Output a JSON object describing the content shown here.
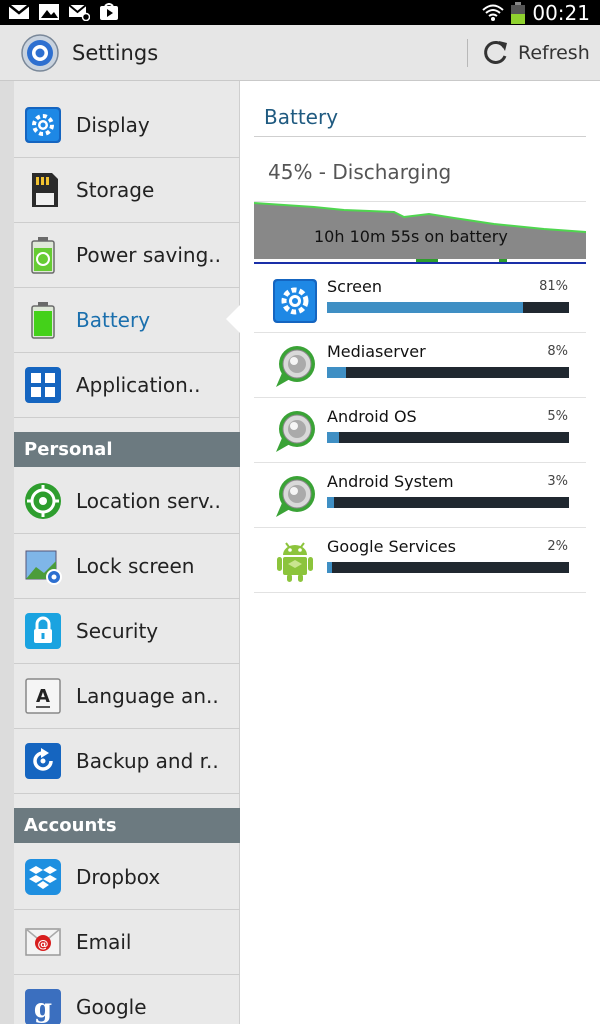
{
  "status_bar": {
    "time": "00:21",
    "icons": [
      "gmail-icon",
      "gallery-icon",
      "email-icon",
      "play-store-icon"
    ]
  },
  "action_bar": {
    "title": "Settings",
    "refresh_label": "Refresh"
  },
  "left_list": {
    "items": [
      {
        "label": "Display",
        "icon": "display-icon"
      },
      {
        "label": "Storage",
        "icon": "sd-card-icon"
      },
      {
        "label": "Power saving..",
        "icon": "power-saving-icon"
      },
      {
        "label": "Battery",
        "icon": "battery-icon",
        "selected": true
      },
      {
        "label": "Application..",
        "icon": "applications-icon"
      }
    ],
    "header_personal": "Personal",
    "personal_items": [
      {
        "label": "Location serv..",
        "icon": "location-icon"
      },
      {
        "label": "Lock screen",
        "icon": "lock-screen-icon"
      },
      {
        "label": "Security",
        "icon": "security-lock-icon"
      },
      {
        "label": "Language an..",
        "icon": "language-icon"
      },
      {
        "label": "Backup and r..",
        "icon": "backup-icon"
      }
    ],
    "header_accounts": "Accounts",
    "account_items": [
      {
        "label": "Dropbox",
        "icon": "dropbox-icon"
      },
      {
        "label": "Email",
        "icon": "email-account-icon"
      },
      {
        "label": "Google",
        "icon": "google-icon"
      }
    ]
  },
  "battery_pane": {
    "title": "Battery",
    "status": "45% - Discharging",
    "graph_label": "10h 10m 55s on battery",
    "apps": [
      {
        "name": "Screen",
        "percent_label": "81%",
        "percent": 81,
        "icon": "screen-gear-icon"
      },
      {
        "name": "Mediaserver",
        "percent_label": "8%",
        "percent": 8,
        "icon": "mediaserver-icon"
      },
      {
        "name": "Android OS",
        "percent_label": "5%",
        "percent": 5,
        "icon": "android-os-icon"
      },
      {
        "name": "Android System",
        "percent_label": "3%",
        "percent": 3,
        "icon": "android-system-icon"
      },
      {
        "name": "Google Services",
        "percent_label": "2%",
        "percent": 2,
        "icon": "android-robot-icon"
      }
    ]
  },
  "colors": {
    "accent": "#3f8fc4",
    "selected_text": "#1a6fad",
    "header_bg": "#6c7a80",
    "graph_line": "#4fd64f"
  }
}
